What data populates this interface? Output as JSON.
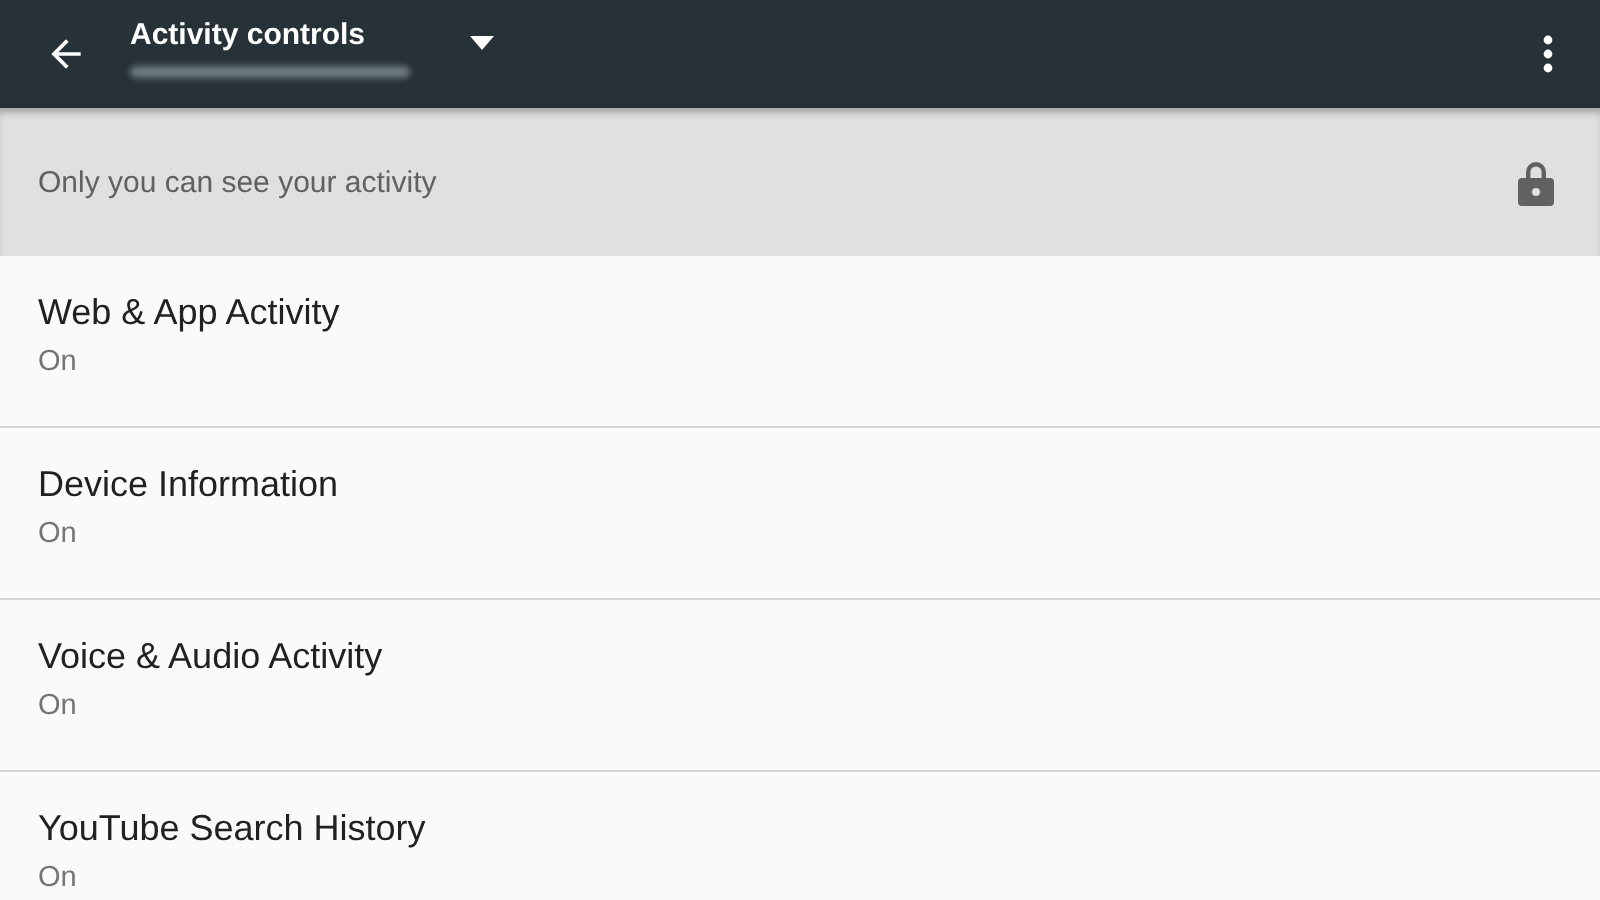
{
  "app_bar": {
    "title": "Activity controls"
  },
  "banner": {
    "text": "Only you can see your activity"
  },
  "settings": [
    {
      "title": "Web & App Activity",
      "status": "On"
    },
    {
      "title": "Device Information",
      "status": "On"
    },
    {
      "title": "Voice & Audio Activity",
      "status": "On"
    },
    {
      "title": "YouTube Search History",
      "status": "On"
    }
  ]
}
